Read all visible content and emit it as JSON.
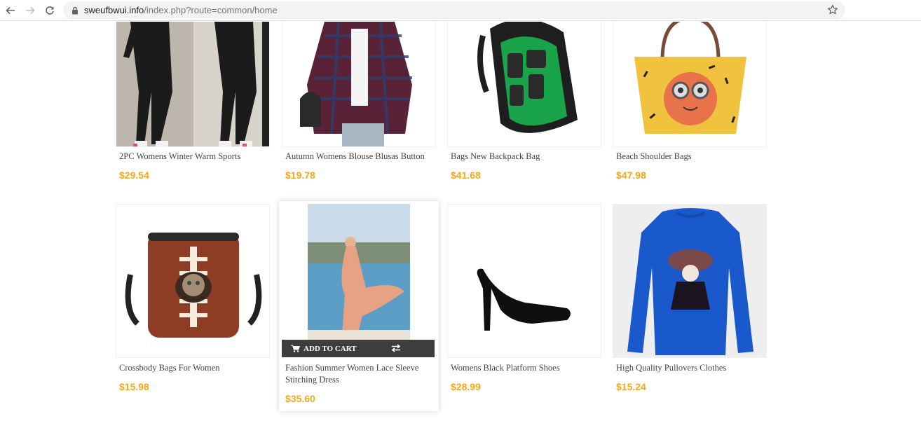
{
  "browser": {
    "url_host": "sweufbwui.info",
    "url_path": "/index.php?route=common/home"
  },
  "products": [
    {
      "name": "2PC Womens Winter Warm Sports",
      "price": "$29.54",
      "image": "woman-black-tracksuit"
    },
    {
      "name": "Autumn Womens Blouse Blusas Button",
      "price": "$19.78",
      "image": "plaid-shirt-blouse"
    },
    {
      "name": "Bags New Backpack Bag",
      "price": "$41.68",
      "image": "camera-backpack"
    },
    {
      "name": "Beach Shoulder Bags",
      "price": "$47.98",
      "image": "yellow-cartoon-tote"
    },
    {
      "name": "Crossbody Bags For Women",
      "price": "$15.98",
      "image": "football-cat-crossbody"
    },
    {
      "name": "Fashion Summer Women Lace Sleeve Stitching Dress",
      "price": "$35.60",
      "image": "peach-summer-dress",
      "actions": {
        "add_to_cart": "ADD TO CART"
      }
    },
    {
      "name": "Womens Black Platform Shoes",
      "price": "$28.99",
      "image": "black-heel-shoe"
    },
    {
      "name": "High Quality Pullovers Clothes",
      "price": "$15.24",
      "image": "blue-sweatshirt"
    }
  ],
  "colors": {
    "price": "#f6a71b",
    "cart_bar": "#3d3d3d"
  }
}
